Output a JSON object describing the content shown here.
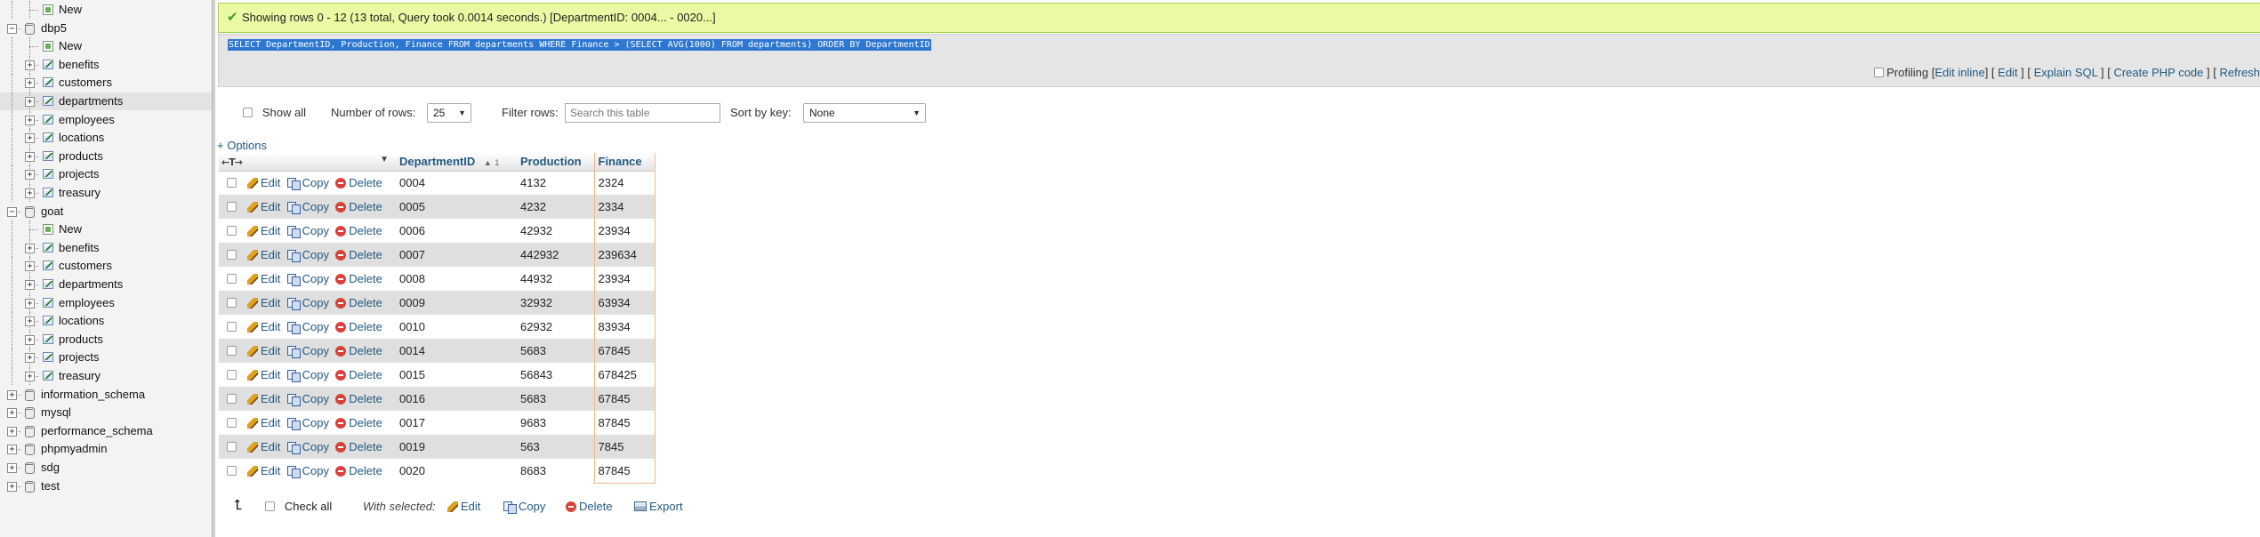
{
  "nav": {
    "items": [
      {
        "label": "New",
        "kind": "new",
        "depth": 1
      },
      {
        "label": "dbp5",
        "kind": "db",
        "depth": 0,
        "toggle": "−"
      },
      {
        "label": "New",
        "kind": "new",
        "depth": 1
      },
      {
        "label": "benefits",
        "kind": "table",
        "depth": 1,
        "toggle": "+"
      },
      {
        "label": "customers",
        "kind": "table",
        "depth": 1,
        "toggle": "+"
      },
      {
        "label": "departments",
        "kind": "table",
        "depth": 1,
        "toggle": "+",
        "active": true
      },
      {
        "label": "employees",
        "kind": "table",
        "depth": 1,
        "toggle": "+"
      },
      {
        "label": "locations",
        "kind": "table",
        "depth": 1,
        "toggle": "+"
      },
      {
        "label": "products",
        "kind": "table",
        "depth": 1,
        "toggle": "+"
      },
      {
        "label": "projects",
        "kind": "table",
        "depth": 1,
        "toggle": "+"
      },
      {
        "label": "treasury",
        "kind": "table",
        "depth": 1,
        "toggle": "+"
      },
      {
        "label": "goat",
        "kind": "db",
        "depth": 0,
        "toggle": "−"
      },
      {
        "label": "New",
        "kind": "new",
        "depth": 1
      },
      {
        "label": "benefits",
        "kind": "table",
        "depth": 1,
        "toggle": "+"
      },
      {
        "label": "customers",
        "kind": "table",
        "depth": 1,
        "toggle": "+"
      },
      {
        "label": "departments",
        "kind": "table",
        "depth": 1,
        "toggle": "+"
      },
      {
        "label": "employees",
        "kind": "table",
        "depth": 1,
        "toggle": "+"
      },
      {
        "label": "locations",
        "kind": "table",
        "depth": 1,
        "toggle": "+"
      },
      {
        "label": "products",
        "kind": "table",
        "depth": 1,
        "toggle": "+"
      },
      {
        "label": "projects",
        "kind": "table",
        "depth": 1,
        "toggle": "+"
      },
      {
        "label": "treasury",
        "kind": "table",
        "depth": 1,
        "toggle": "+"
      },
      {
        "label": "information_schema",
        "kind": "db",
        "depth": 0,
        "toggle": "+"
      },
      {
        "label": "mysql",
        "kind": "db",
        "depth": 0,
        "toggle": "+"
      },
      {
        "label": "performance_schema",
        "kind": "db",
        "depth": 0,
        "toggle": "+"
      },
      {
        "label": "phpmyadmin",
        "kind": "db",
        "depth": 0,
        "toggle": "+"
      },
      {
        "label": "sdg",
        "kind": "db",
        "depth": 0,
        "toggle": "+"
      },
      {
        "label": "test",
        "kind": "db",
        "depth": 0,
        "toggle": "+"
      }
    ]
  },
  "message": {
    "text": "Showing rows 0 - 12 (13 total, Query took 0.0014 seconds.) [DepartmentID: 0004... - 0020...]"
  },
  "sql": {
    "query": "SELECT DepartmentID, Production, Finance FROM departments WHERE Finance > (SELECT AVG(1000) FROM departments) ORDER BY DepartmentID",
    "profiling_label": "Profiling",
    "links": {
      "edit_inline": "Edit inline",
      "edit": "Edit",
      "explain": "Explain SQL",
      "php_code": "Create PHP code",
      "refresh": "Refresh"
    }
  },
  "controls": {
    "show_all": "Show all",
    "num_rows_label": "Number of rows:",
    "num_rows_value": "25",
    "filter_label": "Filter rows:",
    "filter_placeholder": "Search this table",
    "sort_label": "Sort by key:",
    "sort_value": "None"
  },
  "options_link": "+ Options",
  "table": {
    "col_arrows": "←T→",
    "columns": [
      "DepartmentID",
      "Production",
      "Finance"
    ],
    "sort_number": "1",
    "actions": {
      "edit": "Edit",
      "copy": "Copy",
      "delete": "Delete"
    },
    "rows": [
      [
        "0004",
        "4132",
        "2324"
      ],
      [
        "0005",
        "4232",
        "2334"
      ],
      [
        "0006",
        "42932",
        "23934"
      ],
      [
        "0007",
        "442932",
        "239634"
      ],
      [
        "0008",
        "44932",
        "23934"
      ],
      [
        "0009",
        "32932",
        "63934"
      ],
      [
        "0010",
        "62932",
        "83934"
      ],
      [
        "0014",
        "5683",
        "67845"
      ],
      [
        "0015",
        "56843",
        "678425"
      ],
      [
        "0016",
        "5683",
        "67845"
      ],
      [
        "0017",
        "9683",
        "87845"
      ],
      [
        "0019",
        "563",
        "7845"
      ],
      [
        "0020",
        "8683",
        "87845"
      ]
    ]
  },
  "bottom": {
    "check_all": "Check all",
    "with_selected": "With selected:",
    "edit": "Edit",
    "copy": "Copy",
    "delete": "Delete",
    "export": "Export"
  },
  "colors": {
    "success_bg": "#ebf8a4",
    "link": "#235a81",
    "sql_highlight": "#2e77d0",
    "finance_border": "#f2b98c"
  }
}
